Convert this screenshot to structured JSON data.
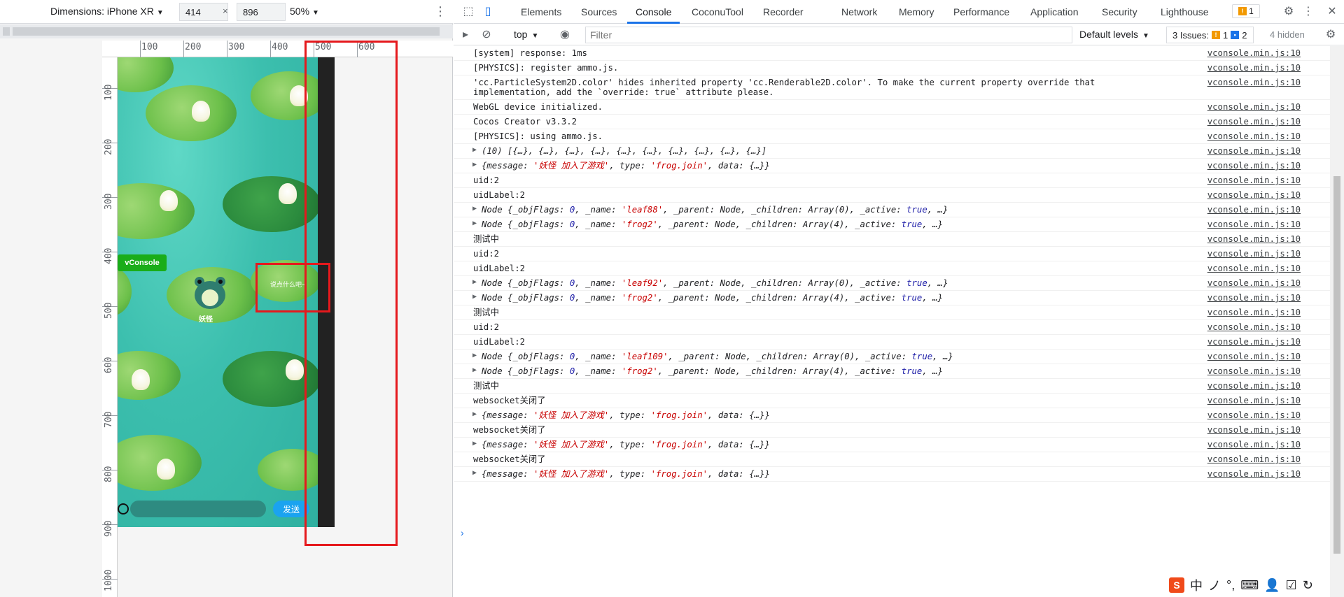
{
  "device_toolbar": {
    "device": "Dimensions: iPhone XR",
    "width": "414",
    "height": "896",
    "x": "×",
    "zoom": "50%"
  },
  "ruler": {
    "top": [
      "100",
      "200",
      "300",
      "400",
      "500",
      "600"
    ],
    "left": [
      "100",
      "200",
      "300",
      "400",
      "500",
      "600",
      "700",
      "800",
      "900",
      "1000"
    ]
  },
  "game": {
    "vconsole_label": "vConsole",
    "frog_name": "妖怪",
    "bubble_text": "说点什么吧~",
    "send_label": "发送"
  },
  "devtools": {
    "tabs": [
      "Elements",
      "Sources",
      "Console",
      "CoconuTool",
      "Recorder",
      "Network",
      "Memory",
      "Performance",
      "Application",
      "Security",
      "Lighthouse"
    ],
    "active_tab": "Console",
    "issue_count": "1",
    "filter": {
      "context": "top",
      "placeholder": "Filter",
      "levels": "Default levels",
      "issues_label": "3 Issues:",
      "issues_warn": "1",
      "issues_info": "2",
      "hidden": "4 hidden"
    }
  },
  "console_rows": [
    {
      "type": "text",
      "msg": "[system] response: 1ms",
      "src": "vconsole.min.js:10"
    },
    {
      "type": "text",
      "msg": "[PHYSICS]: register ammo.js.",
      "src": "vconsole.min.js:10"
    },
    {
      "type": "text2",
      "msg": "'cc.ParticleSystem2D.color' hides inherited property 'cc.Renderable2D.color'. To make the current property override that",
      "msg2": "implementation, add the `override: true` attribute please.",
      "src": "vconsole.min.js:10"
    },
    {
      "type": "text",
      "msg": "WebGL device initialized.",
      "src": "vconsole.min.js:10"
    },
    {
      "type": "text",
      "msg": "Cocos Creator v3.3.2",
      "src": "vconsole.min.js:10"
    },
    {
      "type": "text",
      "msg": "[PHYSICS]: using ammo.js.",
      "src": "vconsole.min.js:10"
    },
    {
      "type": "obj",
      "msg": "(10) [{…}, {…}, {…}, {…}, {…}, {…}, {…}, {…}, {…}, {…}]",
      "src": "vconsole.min.js:10"
    },
    {
      "type": "msg",
      "name": "妖怪 加入了游戏",
      "src": "vconsole.min.js:10"
    },
    {
      "type": "text",
      "msg": "uid:2",
      "src": "vconsole.min.js:10"
    },
    {
      "type": "text",
      "msg": "uidLabel:2",
      "src": "vconsole.min.js:10"
    },
    {
      "type": "node",
      "name": "leaf88",
      "children": "Array(0)",
      "src": "vconsole.min.js:10"
    },
    {
      "type": "node",
      "name": "frog2",
      "children": "Array(4)",
      "src": "vconsole.min.js:10"
    },
    {
      "type": "text",
      "msg": "测试中",
      "src": "vconsole.min.js:10"
    },
    {
      "type": "text",
      "msg": "uid:2",
      "src": "vconsole.min.js:10"
    },
    {
      "type": "text",
      "msg": "uidLabel:2",
      "src": "vconsole.min.js:10"
    },
    {
      "type": "node",
      "name": "leaf92",
      "children": "Array(0)",
      "src": "vconsole.min.js:10"
    },
    {
      "type": "node",
      "name": "frog2",
      "children": "Array(4)",
      "src": "vconsole.min.js:10"
    },
    {
      "type": "text",
      "msg": "测试中",
      "src": "vconsole.min.js:10"
    },
    {
      "type": "text",
      "msg": "uid:2",
      "src": "vconsole.min.js:10"
    },
    {
      "type": "text",
      "msg": "uidLabel:2",
      "src": "vconsole.min.js:10"
    },
    {
      "type": "node",
      "name": "leaf109",
      "children": "Array(0)",
      "src": "vconsole.min.js:10"
    },
    {
      "type": "node",
      "name": "frog2",
      "children": "Array(4)",
      "src": "vconsole.min.js:10"
    },
    {
      "type": "text",
      "msg": "测试中",
      "src": "vconsole.min.js:10"
    },
    {
      "type": "text",
      "msg": "websocket关闭了",
      "src": "vconsole.min.js:10"
    },
    {
      "type": "msg",
      "name": "妖怪 加入了游戏",
      "src": "vconsole.min.js:10"
    },
    {
      "type": "text",
      "msg": "websocket关闭了",
      "src": "vconsole.min.js:10"
    },
    {
      "type": "msg",
      "name": "妖怪 加入了游戏",
      "src": "vconsole.min.js:10"
    },
    {
      "type": "text",
      "msg": "websocket关闭了",
      "src": "vconsole.min.js:10"
    },
    {
      "type": "msg",
      "name": "妖怪 加入了游戏",
      "src": "vconsole.min.js:10"
    }
  ],
  "tray": [
    "中",
    "ノ",
    "°,",
    "⌨",
    "👤",
    "☑",
    "↻"
  ],
  "colors": {
    "accent": "#1a73e8",
    "highlight_box": "#e5191d",
    "vconsole_green": "#1aad19"
  }
}
